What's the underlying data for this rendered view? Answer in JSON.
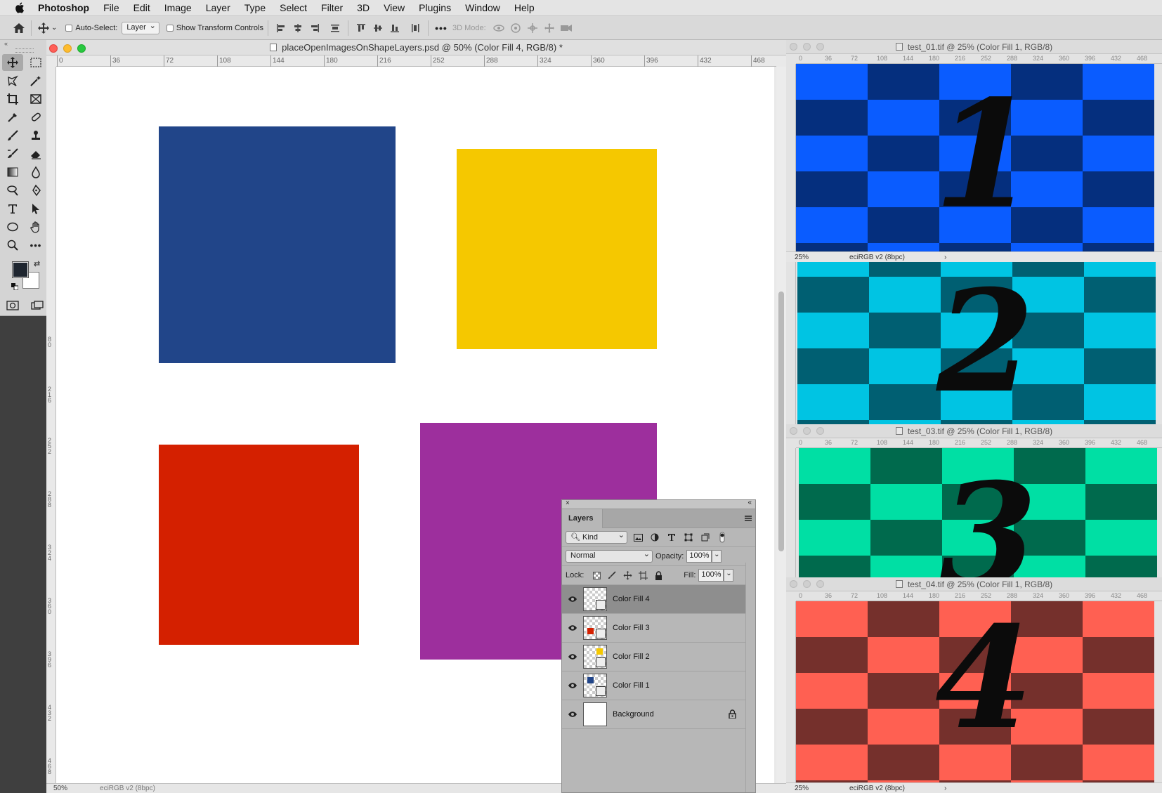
{
  "menubar": {
    "app": "Photoshop",
    "items": [
      "File",
      "Edit",
      "Image",
      "Layer",
      "Type",
      "Select",
      "Filter",
      "3D",
      "View",
      "Plugins",
      "Window",
      "Help"
    ]
  },
  "options": {
    "auto_select_label": "Auto-Select:",
    "auto_select_target": "Layer",
    "transform_controls_label": "Show Transform Controls",
    "mode3d_label": "3D Mode:"
  },
  "document": {
    "title": "placeOpenImagesOnShapeLayers.psd @ 50% (Color Fill 4, RGB/8) *",
    "ruler_h": [
      "0",
      "36",
      "72",
      "108",
      "144",
      "180",
      "216",
      "252",
      "288",
      "324",
      "360",
      "396",
      "432",
      "468"
    ],
    "ruler_v": [
      "80",
      "216",
      "252",
      "288",
      "324",
      "360",
      "396",
      "432",
      "468"
    ],
    "zoom": "50%",
    "profile": "eciRGB v2 (8bpc)",
    "shapes": [
      {
        "name": "Color Fill 1",
        "color": "#214589"
      },
      {
        "name": "Color Fill 2",
        "color": "#f5c800"
      },
      {
        "name": "Color Fill 3",
        "color": "#d42000"
      },
      {
        "name": "Color Fill 4",
        "color": "#9d2f9d"
      }
    ]
  },
  "layers_panel": {
    "tab": "Layers",
    "kind": "Kind",
    "blend_mode": "Normal",
    "opacity_label": "Opacity:",
    "opacity": "100%",
    "lock_label": "Lock:",
    "fill_label": "Fill:",
    "fill": "100%",
    "layers": [
      {
        "name": "Color Fill 4",
        "swatch": "#9d2f9d",
        "active": true
      },
      {
        "name": "Color Fill 3",
        "swatch": "#d42000",
        "active": false
      },
      {
        "name": "Color Fill 2",
        "swatch": "#f5c800",
        "active": false
      },
      {
        "name": "Color Fill 1",
        "swatch": "#214589",
        "active": false
      },
      {
        "name": "Background",
        "swatch": "#ffffff",
        "active": false
      }
    ]
  },
  "image_windows": [
    {
      "title": "test_01.tif @ 25% (Color Fill 1, RGB/8)",
      "digit": "1",
      "light": "#0a5cff",
      "dark": "#052f7e",
      "zoom": "25%",
      "profile": "eciRGB v2 (8bpc)"
    },
    {
      "title": "",
      "digit": "2",
      "light": "#00c4e3",
      "dark": "#005f72",
      "zoom": "",
      "profile": ""
    },
    {
      "title": "test_03.tif @ 25% (Color Fill 1, RGB/8)",
      "digit": "3",
      "light": "#00dfa4",
      "dark": "#006a4d",
      "zoom": "",
      "profile": ""
    },
    {
      "title": "test_04.tif @ 25% (Color Fill 1, RGB/8)",
      "digit": "4",
      "light": "#ff6052",
      "dark": "#75302c",
      "zoom": "25%",
      "profile": "eciRGB v2 (8bpc)"
    }
  ],
  "small_ruler": [
    "0",
    "36",
    "72",
    "108",
    "144",
    "180",
    "216",
    "252",
    "288",
    "324",
    "360",
    "396",
    "432",
    "468"
  ]
}
